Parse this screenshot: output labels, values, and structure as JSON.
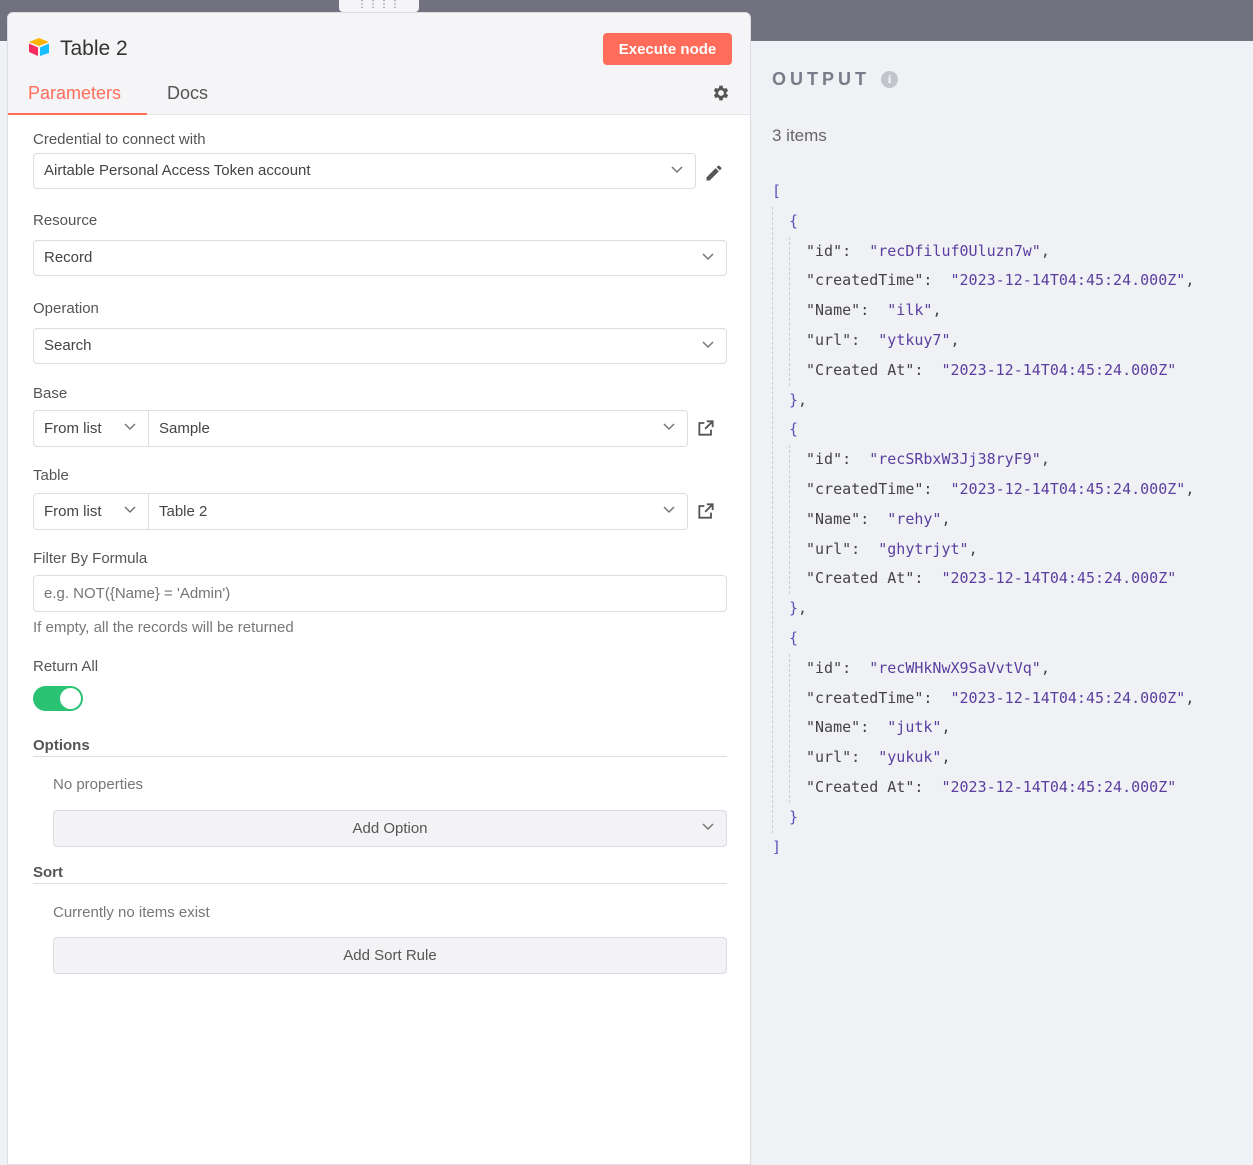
{
  "panel": {
    "node_title": "Table 2",
    "execute_label": "Execute node",
    "tabs": [
      {
        "label": "Parameters"
      },
      {
        "label": "Docs"
      }
    ],
    "credential": {
      "label": "Credential to connect with",
      "value": "Airtable Personal Access Token account"
    },
    "resource": {
      "label": "Resource",
      "value": "Record"
    },
    "operation": {
      "label": "Operation",
      "value": "Search"
    },
    "base": {
      "label": "Base",
      "mode": "From list",
      "value": "Sample"
    },
    "table": {
      "label": "Table",
      "mode": "From list",
      "value": "Table 2"
    },
    "filter": {
      "label": "Filter By Formula",
      "placeholder": "e.g. NOT({Name} = 'Admin')",
      "hint": "If empty, all the records will be returned"
    },
    "return_all": {
      "label": "Return All",
      "enabled": true
    },
    "options": {
      "title": "Options",
      "empty_text": "No properties",
      "button": "Add Option"
    },
    "sort": {
      "title": "Sort",
      "empty_text": "Currently no items exist",
      "button": "Add Sort Rule"
    }
  },
  "output": {
    "title": "OUTPUT",
    "count": "3 items",
    "items": [
      {
        "id": "recDfiluf0Uluzn7w",
        "createdTime": "2023-12-14T04:45:24.000Z",
        "Name": "ilk",
        "url": "ytkuy7",
        "Created At": "2023-12-14T04:45:24.000Z"
      },
      {
        "id": "recSRbxW3Jj38ryF9",
        "createdTime": "2023-12-14T04:45:24.000Z",
        "Name": "rehy",
        "url": "ghytrjyt",
        "Created At": "2023-12-14T04:45:24.000Z"
      },
      {
        "id": "recWHkNwX9SaVvtVq",
        "createdTime": "2023-12-14T04:45:24.000Z",
        "Name": "jutk",
        "url": "yukuk",
        "Created At": "2023-12-14T04:45:24.000Z"
      }
    ]
  },
  "colors": {
    "accent": "#ff6d5a",
    "toggle_on": "#29c373",
    "json_string": "#5b3fa0"
  },
  "icons": [
    "airtable-logo-icon",
    "gear-icon",
    "pencil-icon",
    "external-link-icon",
    "chevron-down-icon",
    "info-icon",
    "drag-handle-icon"
  ]
}
